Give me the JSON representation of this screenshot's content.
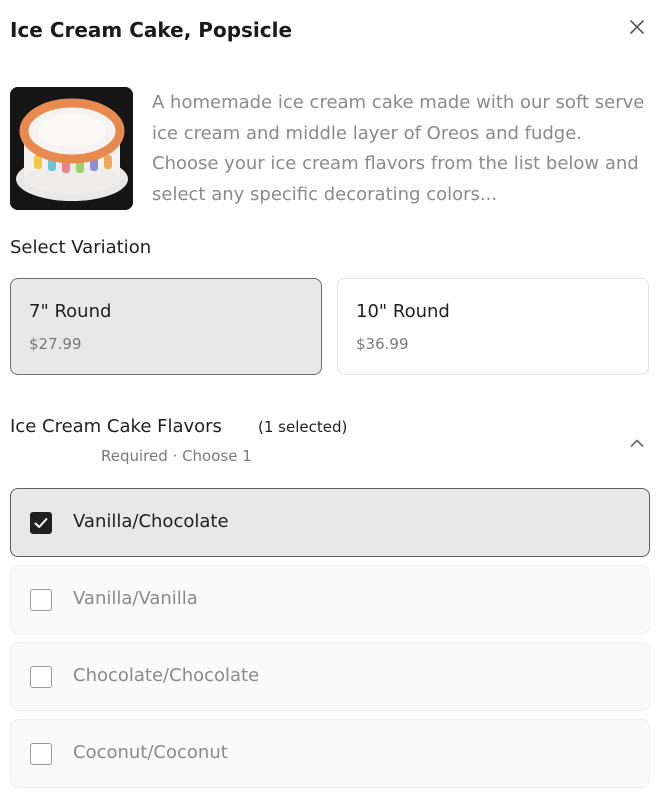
{
  "modal": {
    "title": "Ice Cream Cake, Popsicle",
    "close_icon": "close-icon"
  },
  "product": {
    "image_icon": "cake-image",
    "description": "A homemade ice cream cake made with our soft serve ice cream and middle layer of Oreos and fudge. Choose your ice cream flavors from the list below and select any specific decorating colors..."
  },
  "variations": {
    "label": "Select Variation",
    "items": [
      {
        "name": "7\" Round",
        "price": "$27.99",
        "selected": true
      },
      {
        "name": "10\" Round",
        "price": "$36.99",
        "selected": false
      }
    ]
  },
  "flavors": {
    "title": "Ice Cream Cake Flavors",
    "count": "(1 selected)",
    "subtitle": "Required · Choose 1",
    "chevron_icon": "chevron-up-icon",
    "options": [
      {
        "label": "Vanilla/Chocolate",
        "checked": true
      },
      {
        "label": "Vanilla/Vanilla",
        "checked": false
      },
      {
        "label": "Chocolate/Chocolate",
        "checked": false
      },
      {
        "label": "Coconut/Coconut",
        "checked": false
      }
    ]
  },
  "colors": {
    "text": "#1f1f1f",
    "muted": "#8a8a8a",
    "selected_bg": "#e8e8e8",
    "frosting": "#e88a4e"
  }
}
